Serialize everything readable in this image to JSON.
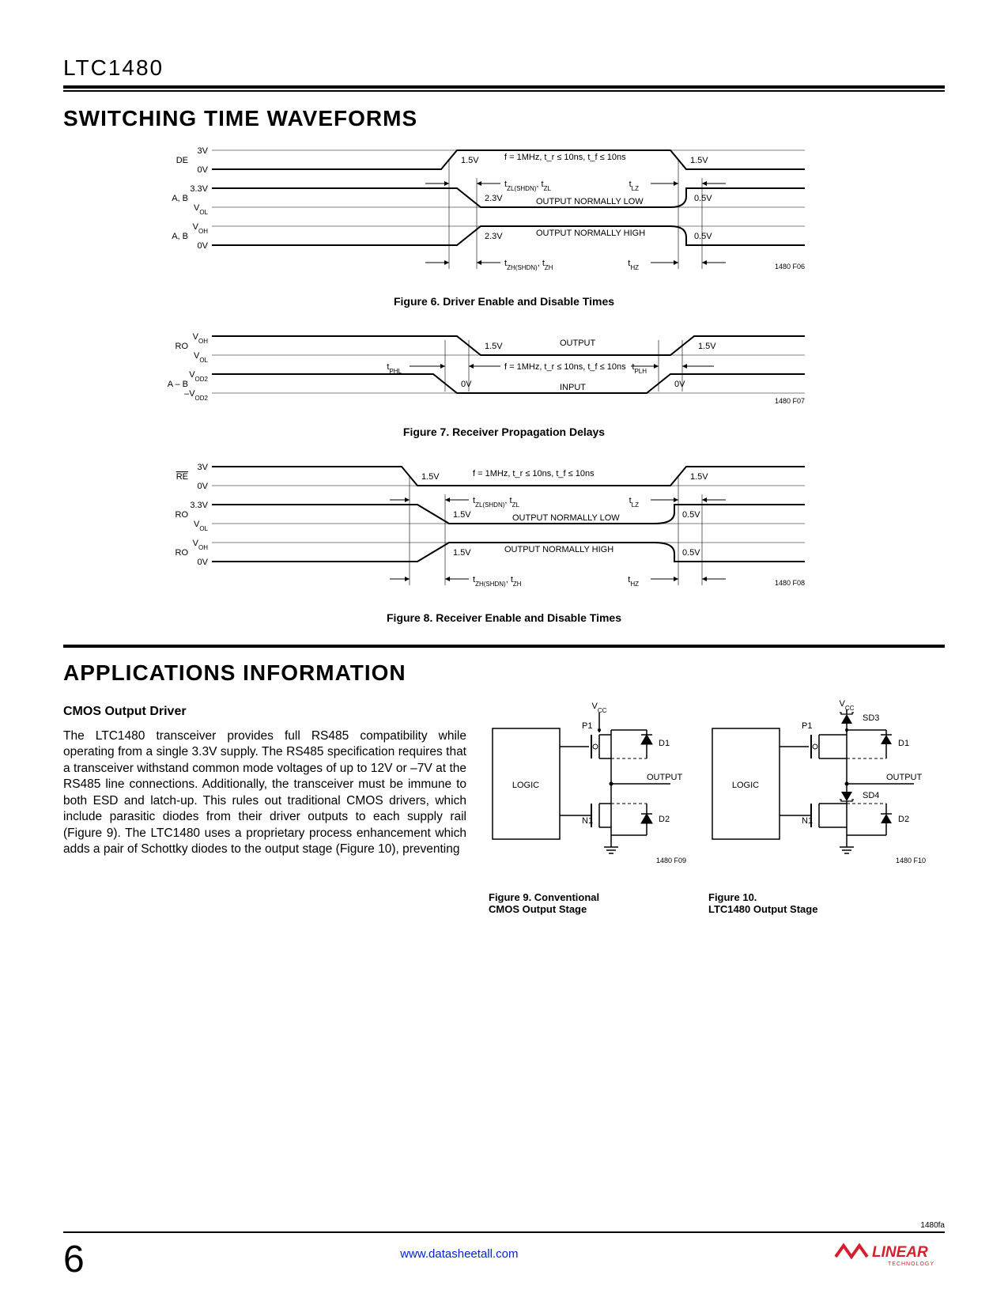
{
  "part": "LTC1480",
  "section1": "SWITCHING TIME WAVEFORMS",
  "section2": "APPLICATIONS INFORMATION",
  "fig6": {
    "id": "1480 F06",
    "caption": "Figure 6. Driver Enable and Disable Times",
    "sig1": {
      "name": "DE",
      "hi": "3V",
      "lo": "0V",
      "thresh": "1.5V",
      "thresh2": "1.5V"
    },
    "sig2": {
      "name": "A, B",
      "hi": "3.3V",
      "lo": "V_OL",
      "thresh": "2.3V",
      "note": "OUTPUT NORMALLY LOW",
      "r": "0.5V"
    },
    "sig3": {
      "name": "A, B",
      "hi": "V_OH",
      "lo": "0V",
      "thresh": "2.3V",
      "note": "OUTPUT NORMALLY HIGH",
      "r": "0.5V"
    },
    "cond": "f = 1MHz, t_r ≤ 10ns, t_f ≤ 10ns",
    "t1": "t_ZL(SHDN), t_ZL",
    "t2": "t_LZ",
    "t3": "t_ZH(SHDN), t_ZH",
    "t4": "t_HZ"
  },
  "fig7": {
    "id": "1480 F07",
    "caption": "Figure 7. Receiver Propagation Delays",
    "sig1": {
      "name": "RO",
      "hi": "V_OH",
      "lo": "V_OL",
      "thresh": "1.5V",
      "thresh2": "1.5V",
      "note": "OUTPUT"
    },
    "sig2": {
      "name": "A – B",
      "hi": "V_OD2",
      "lo": "–V_OD2",
      "thresh": "0V",
      "thresh2": "0V",
      "note": "INPUT"
    },
    "cond": "f = 1MHz, t_r ≤ 10ns, t_f ≤ 10ns",
    "t1": "t_PHL",
    "t2": "t_PLH"
  },
  "fig8": {
    "id": "1480 F08",
    "caption": "Figure 8. Receiver Enable and Disable Times",
    "sig1": {
      "name": "RE",
      "hi": "3V",
      "lo": "0V",
      "thresh": "1.5V",
      "thresh2": "1.5V",
      "bar": true
    },
    "sig2": {
      "name": "RO",
      "hi": "3.3V",
      "lo": "V_OL",
      "thresh": "1.5V",
      "note": "OUTPUT NORMALLY LOW",
      "r": "0.5V"
    },
    "sig3": {
      "name": "RO",
      "hi": "V_OH",
      "lo": "0V",
      "thresh": "1.5V",
      "note": "OUTPUT NORMALLY HIGH",
      "r": "0.5V"
    },
    "cond": "f = 1MHz, t_r ≤ 10ns, t_f ≤ 10ns",
    "t1": "t_ZL(SHDN), t_ZL",
    "t2": "t_LZ",
    "t3": "t_ZH(SHDN), t_ZH",
    "t4": "t_HZ"
  },
  "apps": {
    "heading": "CMOS Output Driver",
    "body": "The LTC1480 transceiver provides full RS485 compatibility while operating from a single 3.3V supply. The RS485 specification requires that a transceiver withstand common mode voltages of up to 12V or –7V at the RS485 line connections. Additionally, the transceiver must be immune to both ESD and latch-up. This rules out traditional CMOS drivers, which include parasitic diodes from their driver outputs to each supply rail (Figure 9). The LTC1480 uses a proprietary process enhancement which adds a pair of Schottky diodes to the output stage (Figure 10), preventing"
  },
  "fig9": {
    "id": "1480 F09",
    "caption": "Figure 9. Conventional CMOS Output Stage",
    "vcc": "V_CC",
    "p1": "P1",
    "n1": "N1",
    "d1": "D1",
    "d2": "D2",
    "out": "OUTPUT",
    "logic": "LOGIC"
  },
  "fig10": {
    "id": "1480 F10",
    "caption": "Figure 10. LTC1480 Output Stage",
    "vcc": "V_CC",
    "p1": "P1",
    "n1": "N1",
    "d1": "D1",
    "d2": "D2",
    "sd3": "SD3",
    "sd4": "SD4",
    "out": "OUTPUT",
    "logic": "LOGIC"
  },
  "footer": {
    "page": "6",
    "url": "www.datasheetall.com",
    "docid": "1480fa",
    "brand": "LINEAR",
    "brandsub": "TECHNOLOGY"
  }
}
